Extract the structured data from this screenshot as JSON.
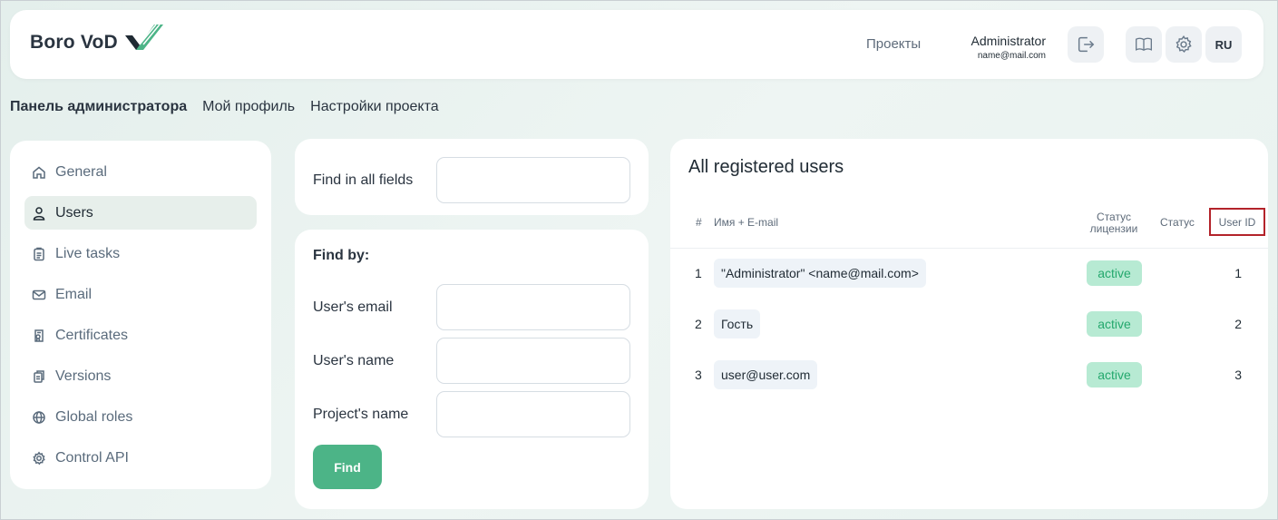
{
  "header": {
    "logo_text": "Boro VoD",
    "nav_projects": "Проекты",
    "user_name": "Administrator",
    "user_email": "name@mail.com",
    "lang": "RU",
    "icons": [
      "logout-icon",
      "book-icon",
      "gear-icon"
    ]
  },
  "topnav": {
    "admin_panel": "Панель администратора",
    "my_profile": "Мой профиль",
    "project_settings": "Настройки проекта"
  },
  "sidebar": {
    "items": [
      {
        "label": "General",
        "icon": "home-icon"
      },
      {
        "label": "Users",
        "icon": "user-icon",
        "active": true
      },
      {
        "label": "Live tasks",
        "icon": "clipboard-icon"
      },
      {
        "label": "Email",
        "icon": "mail-icon"
      },
      {
        "label": "Certificates",
        "icon": "certificate-icon"
      },
      {
        "label": "Versions",
        "icon": "versions-icon"
      },
      {
        "label": "Global roles",
        "icon": "globe-icon"
      },
      {
        "label": "Control API",
        "icon": "cog-icon"
      }
    ]
  },
  "search": {
    "find_all_label": "Find in all fields",
    "find_all_value": ""
  },
  "filter": {
    "title": "Find by:",
    "email_label": "User's email",
    "name_label": "User's name",
    "project_label": "Project's name",
    "find_button": "Find"
  },
  "users": {
    "title": "All registered users",
    "columns": {
      "hash": "#",
      "name": "Имя + E-mail",
      "license_status_line1": "Статус",
      "license_status_line2": "лицензии",
      "status": "Статус",
      "user_id": "User ID"
    },
    "rows": [
      {
        "num": "1",
        "name": "\"Administrator\" <name@mail.com>",
        "license": "active",
        "status": "",
        "id": "1"
      },
      {
        "num": "2",
        "name": "Гость",
        "license": "active",
        "status": "",
        "id": "2"
      },
      {
        "num": "3",
        "name": "user@user.com",
        "license": "active",
        "status": "",
        "id": "3"
      }
    ]
  },
  "colors": {
    "accent": "#4cb487",
    "active_badge_bg": "#b7ead3",
    "active_badge_text": "#24a86d",
    "highlight_border": "#b3232a"
  }
}
